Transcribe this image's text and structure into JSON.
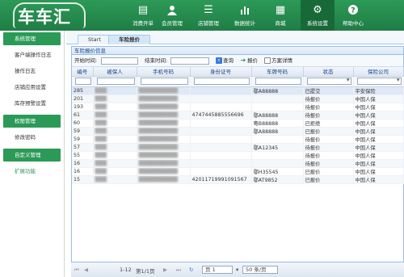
{
  "header": {
    "logo": "车车汇",
    "nav": [
      {
        "label": "消费开单",
        "icon": "cart-icon",
        "glyph": "▤"
      },
      {
        "label": "会员管理",
        "icon": "user-icon",
        "glyph": "👤"
      },
      {
        "label": "店铺管理",
        "icon": "list-icon",
        "glyph": "☰"
      },
      {
        "label": "数据统计",
        "icon": "bar-chart-icon",
        "glyph": "▮"
      },
      {
        "label": "商城",
        "icon": "store-icon",
        "glyph": "▦"
      },
      {
        "label": "系统设置",
        "icon": "gear-icon",
        "glyph": "⚙"
      },
      {
        "label": "帮助中心",
        "icon": "help-icon",
        "glyph": "?"
      }
    ]
  },
  "sidebar": {
    "groups": [
      {
        "title": "系统管理",
        "items": [
          "客户端操作日志",
          "操作日志",
          "店铺应用设置",
          "库存预警设置"
        ]
      },
      {
        "title": "权限管理",
        "items": [
          "修改密码"
        ]
      },
      {
        "title": "自定义管理",
        "items": [
          "扩展功能"
        ]
      }
    ]
  },
  "tabs": [
    "Start",
    "车险报价"
  ],
  "panel": {
    "title": "车险报价信息",
    "toolbar": {
      "start_label": "开始时间:",
      "end_label": "结束时间:",
      "query": "查询",
      "quote": "报价",
      "plan": "方案详情"
    }
  },
  "table": {
    "columns": [
      "编号",
      "被保人",
      "手机号码",
      "身份证号",
      "车牌号码",
      "状态",
      "保险公司"
    ],
    "rows": [
      [
        "285",
        "",
        "",
        "",
        "鄂A88888",
        "已提交",
        "平安保险"
      ],
      [
        "201",
        "",
        "",
        "",
        "",
        "待报价",
        "中国人保"
      ],
      [
        "193",
        "",
        "",
        "",
        "",
        "待报价",
        "中国人保"
      ],
      [
        "61",
        "",
        "",
        "4747445885556696",
        "鄂A88888",
        "待报价",
        "中国人保"
      ],
      [
        "60",
        "",
        "",
        "",
        "粤B88888",
        "已拒绝",
        "中国人保"
      ],
      [
        "59",
        "",
        "",
        "",
        "鄂A88888",
        "已报价",
        "中国人保"
      ],
      [
        "59",
        "",
        "",
        "",
        "",
        "待报价",
        "中国人保"
      ],
      [
        "57",
        "",
        "",
        "",
        "鄂A12345",
        "待报价",
        "中国人保"
      ],
      [
        "55",
        "",
        "",
        "",
        "",
        "待报价",
        "中国人保"
      ],
      [
        "16",
        "",
        "",
        "",
        "",
        "待报价",
        "中国人保"
      ],
      [
        "16",
        "",
        "",
        "",
        "鄂H35545",
        "已报价",
        "中国人保"
      ],
      [
        "15",
        "",
        "",
        "42011719991091567",
        "鄂AT9852",
        "已报价",
        "中国人保"
      ]
    ]
  },
  "pager": {
    "range": "1-12",
    "page_info": "第1/1页",
    "page": "页 1",
    "page_size": "50 条/页"
  }
}
